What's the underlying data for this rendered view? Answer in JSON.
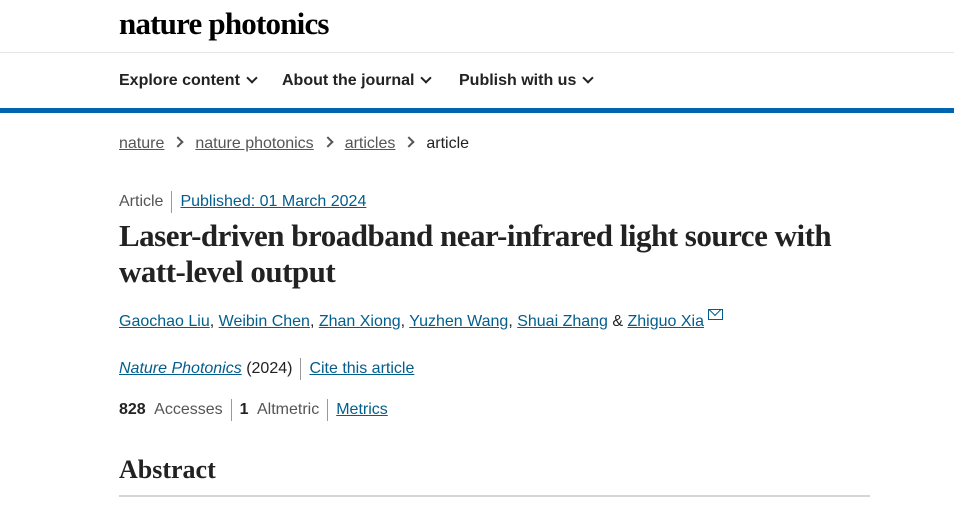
{
  "site": {
    "logo_text": "nature photonics"
  },
  "nav": {
    "items": [
      {
        "label": "Explore content"
      },
      {
        "label": "About the journal"
      },
      {
        "label": "Publish with us"
      }
    ]
  },
  "breadcrumb": {
    "items": [
      "nature",
      "nature photonics",
      "articles"
    ],
    "current": "article"
  },
  "article": {
    "type": "Article",
    "published": "Published: 01 March 2024",
    "title": "Laser-driven broadband near-infrared light source with watt-level output",
    "authors": [
      "Gaochao Liu",
      "Weibin Chen",
      "Zhan Xiong",
      "Yuzhen Wang",
      "Shuai Zhang",
      "Zhiguo Xia"
    ],
    "author_separator": ", ",
    "author_conjunction": " & ",
    "journal": "Nature Photonics",
    "year": "(2024)",
    "cite_label": "Cite this article"
  },
  "metrics": {
    "accesses_count": "828",
    "accesses_label": "Accesses",
    "altmetric_count": "1",
    "altmetric_label": "Altmetric",
    "metrics_link": "Metrics"
  },
  "abstract": {
    "heading": "Abstract"
  },
  "colors": {
    "accent": "#0066b0",
    "link": "#025e8d",
    "text": "#222222"
  },
  "icons": [
    "chevron-down-icon",
    "chevron-right-icon",
    "mail-icon"
  ]
}
